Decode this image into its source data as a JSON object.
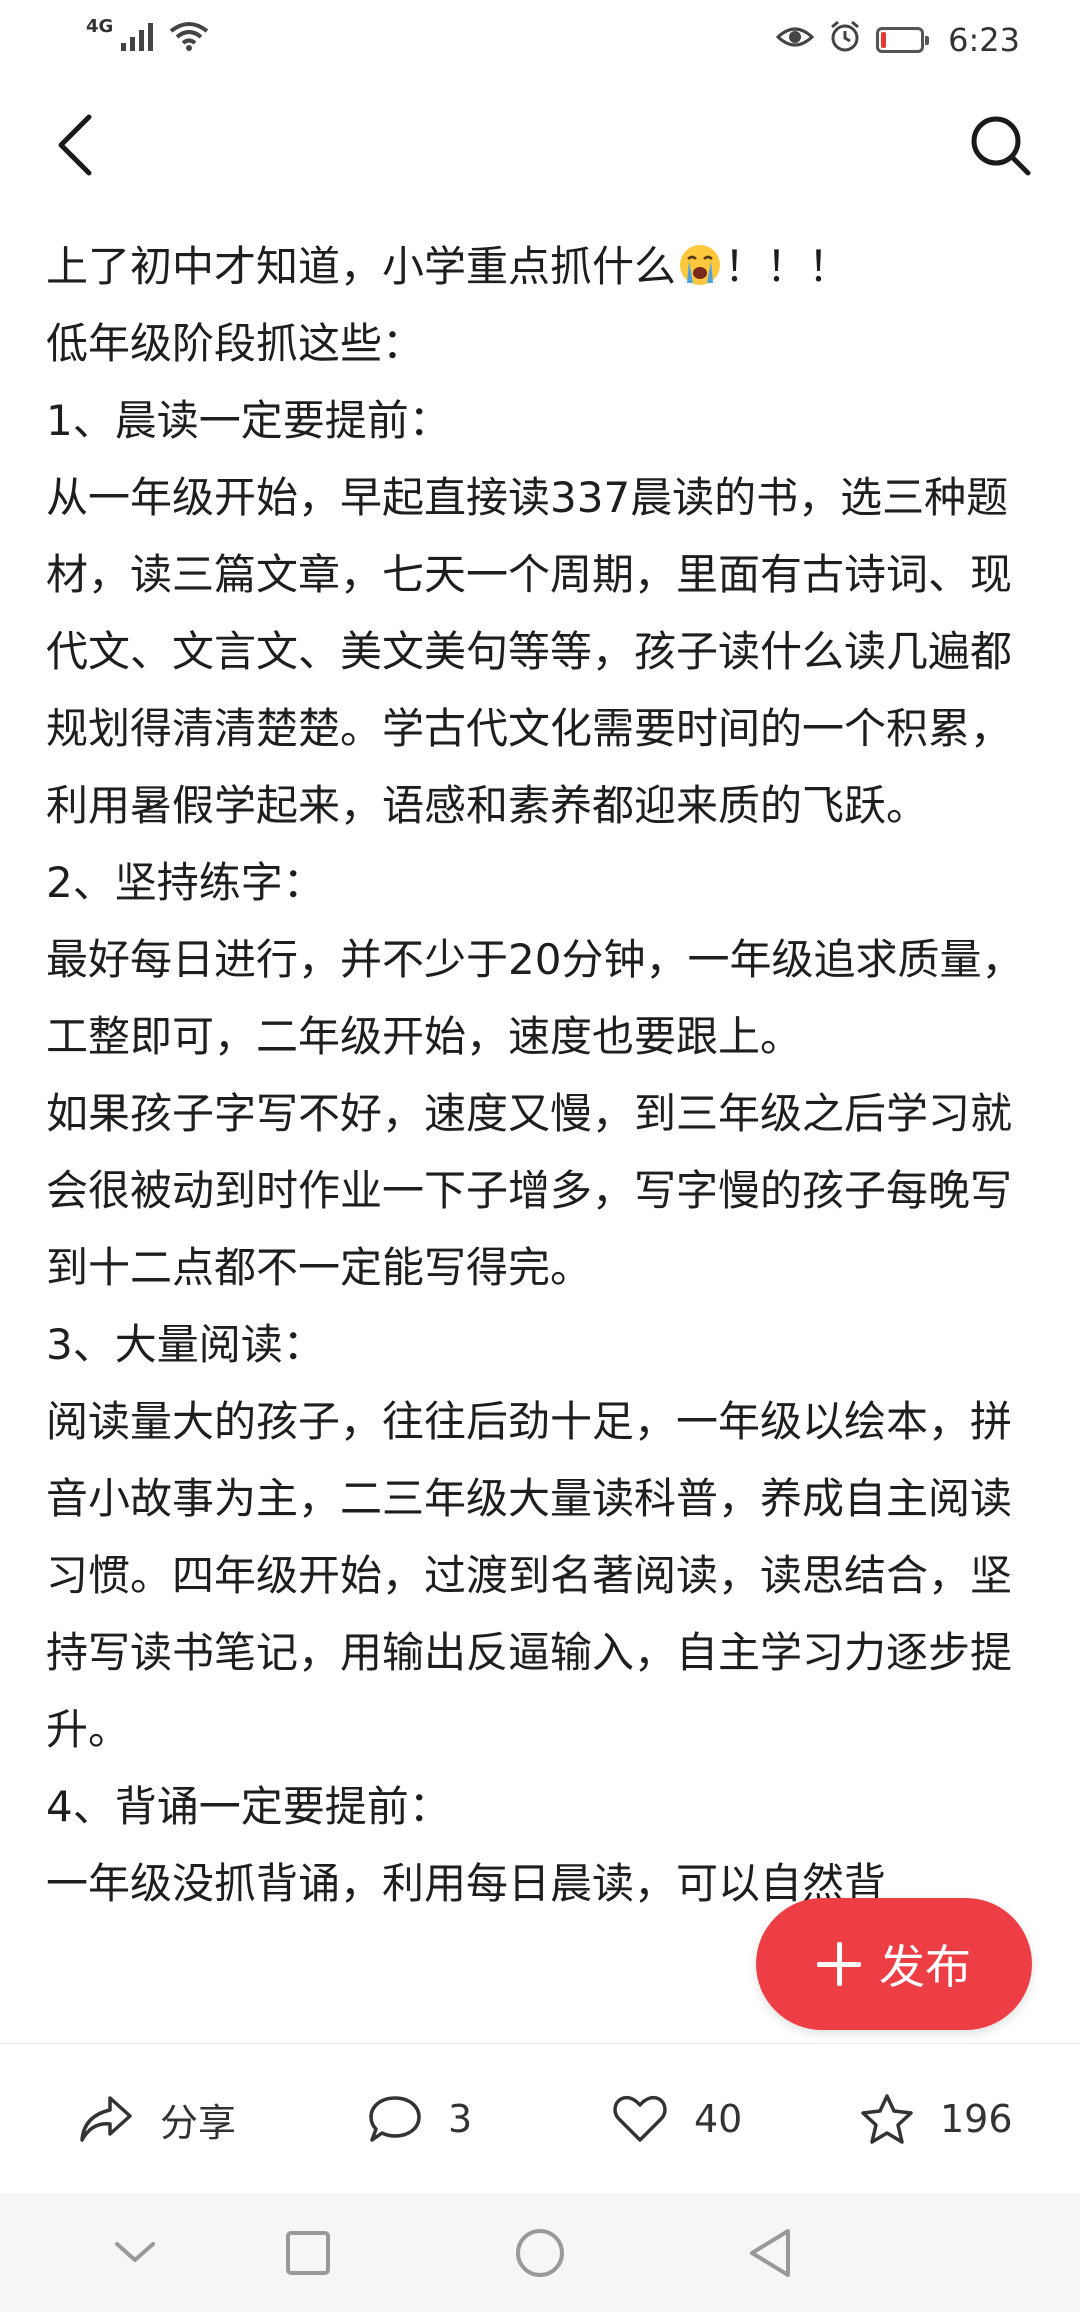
{
  "status_bar": {
    "network": "4G",
    "time": "6:23",
    "battery_level": 0.12,
    "battery_color": "#e53935",
    "icons": [
      "signal-icon",
      "wifi-icon",
      "eye-icon",
      "alarm-icon",
      "battery-icon"
    ]
  },
  "header": {
    "back_icon": "chevron-left-icon",
    "search_icon": "search-icon"
  },
  "article": {
    "paragraphs": [
      "上了初中才知道，小学重点抓什么",
      "！！！",
      "低年级阶段抓这些：",
      "1、晨读一定要提前：",
      "从一年级开始，早起直接读337晨读的书，选三种题材，读三篇文章，七天一个周期，里面有古诗词、现代文、文言文、美文美句等等，孩子读什么读几遍都规划得清清楚楚。学古代文化需要时间的一个积累，利用暑假学起来，语感和素养都迎来质的飞跃。",
      "2、坚持练字：",
      "最好每日进行，并不少于20分钟，一年级追求质量，工整即可，二年级开始，速度也要跟上。",
      "如果孩子字写不好，速度又慢，到三年级之后学习就会很被动到时作业一下子增多，写字慢的孩子每晚写到十二点都不一定能写得完。",
      "3、大量阅读：",
      "阅读量大的孩子，往往后劲十足，一年级以绘本，拼音小故事为主，二三年级大量读科普，养成自主阅读习惯。四年级开始，过渡到名著阅读，读思结合，坚持写读书笔记，用输出反逼输入，自主学习力逐步提升。",
      "4、背诵一定要提前：",
      "一年级没抓背诵，利用每日晨读，可以自然背"
    ]
  },
  "publish": {
    "label": "发布",
    "color": "#ee3e45"
  },
  "actions": {
    "share_label": "分享",
    "comment_count": "3",
    "like_count": "40",
    "favorite_count": "196"
  },
  "nav": {
    "keys": [
      "chevron-down-icon",
      "square-icon",
      "circle-icon",
      "triangle-back-icon"
    ]
  }
}
